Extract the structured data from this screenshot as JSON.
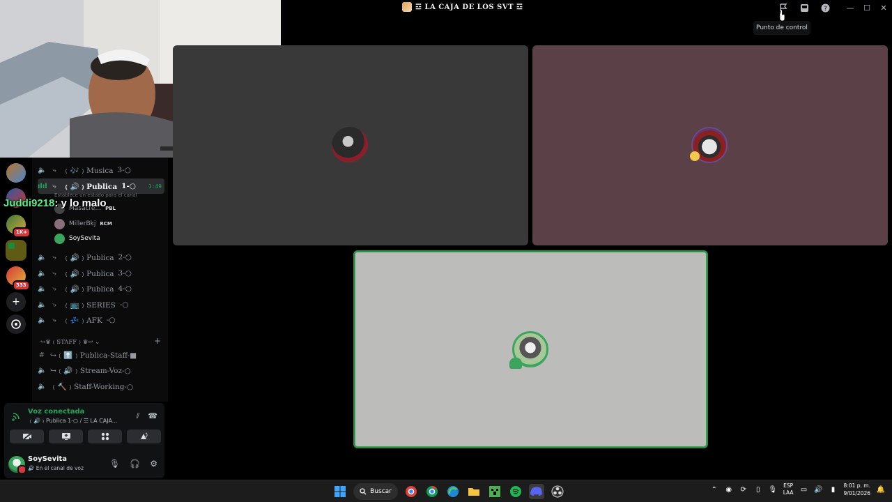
{
  "window": {
    "title": "☲ LA CAJA DE LOS SVT ☲",
    "tooltip": "Punto de control",
    "icons": [
      "checkpoint-icon",
      "inbox-icon",
      "help-icon"
    ],
    "controls": [
      "minimize",
      "maximize",
      "close"
    ]
  },
  "overlay_chat": {
    "username": "Juddi9218",
    "message": ": y lo malo"
  },
  "servers": {
    "badges": [
      "1K+",
      "333"
    ]
  },
  "channels": [
    {
      "name": "﹙🎶﹚Musica",
      "suffix": "3-○"
    },
    {
      "name": "﹙🔊﹚Publica",
      "suffix": "1-○",
      "time": "1:49",
      "status_hint": "Establece un estado para el canal"
    },
    {
      "name": "﹙🔊﹚Publica",
      "suffix": "2-○"
    },
    {
      "name": "﹙🔊﹚Publica",
      "suffix": "3-○"
    },
    {
      "name": "﹙🔊﹚Publica",
      "suffix": "4-○"
    },
    {
      "name": "﹙📺﹚SERIES",
      "suffix": "-○"
    },
    {
      "name": "﹙💤﹚AFK",
      "suffix": "-○"
    }
  ],
  "voice_users": [
    {
      "name": "Masacre...",
      "tag": "PBL"
    },
    {
      "name": "MillerBkj",
      "tag": "RCM"
    },
    {
      "name": "SoySevita",
      "tag": ""
    }
  ],
  "staff_category": {
    "label": "↪♛﹙STAFF﹚♛↩ ⌄",
    "channels": [
      {
        "name": "↪﹙⬆️﹚Publica-Staff-■",
        "kind": "text"
      },
      {
        "name": "↪﹙🔊﹚Stream-Voz-○",
        "kind": "voice"
      },
      {
        "name": "﹙🔨﹚Staff-Working-○",
        "kind": "voice"
      }
    ]
  },
  "voice_panel": {
    "status": "Voz conectada",
    "channel": "﹙🔊﹚Publica 1-○ / ☲ LA CAJA..."
  },
  "self_user": {
    "name": "SoySevita",
    "subtext": "🔊 En el canal de voz"
  },
  "taskbar": {
    "search_label": "Buscar",
    "lang_top": "ESP",
    "lang_bottom": "LAA",
    "time": "8:01 p. m.",
    "date": "9/01/2026"
  },
  "colors": {
    "accent_green": "#23a55a",
    "speaking_border": "#3ba55d",
    "tile_1": "#393939",
    "tile_2": "#5b4047",
    "tile_3": "#bcbcbb"
  }
}
